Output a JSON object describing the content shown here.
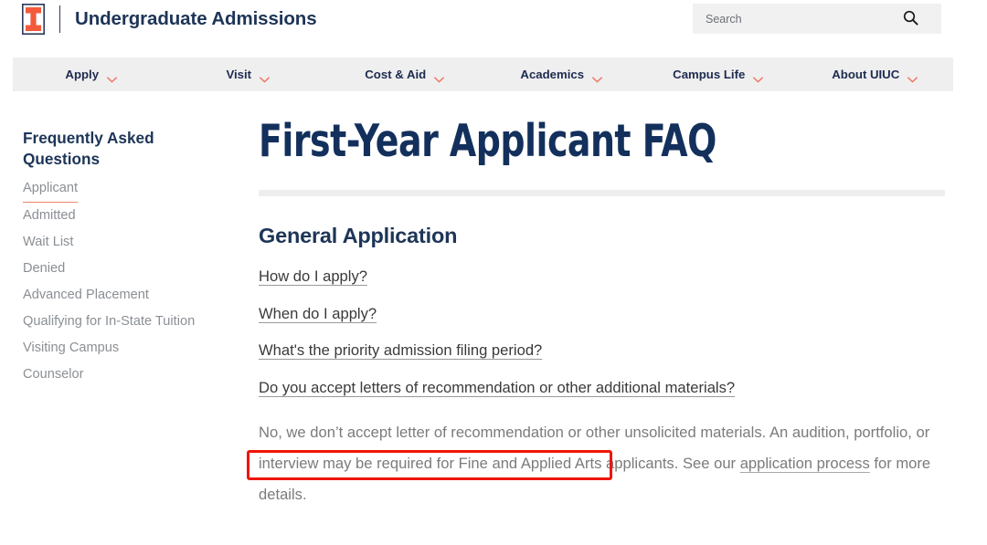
{
  "header": {
    "logo_icon": "illinois-block-i-logo",
    "title": "Undergraduate Admissions",
    "search": {
      "placeholder": "Search",
      "value": "",
      "icon": "search-icon"
    }
  },
  "nav": {
    "items": [
      {
        "label": "Apply",
        "icon": "chevron-down-icon"
      },
      {
        "label": "Visit",
        "icon": "chevron-down-icon"
      },
      {
        "label": "Cost & Aid",
        "icon": "chevron-down-icon"
      },
      {
        "label": "Academics",
        "icon": "chevron-down-icon"
      },
      {
        "label": "Campus Life",
        "icon": "chevron-down-icon"
      },
      {
        "label": "About UIUC",
        "icon": "chevron-down-icon"
      }
    ]
  },
  "sidebar": {
    "title": "Frequently Asked Questions",
    "items": [
      {
        "label": "Applicant",
        "active": true
      },
      {
        "label": "Admitted",
        "active": false
      },
      {
        "label": "Wait List",
        "active": false
      },
      {
        "label": "Denied",
        "active": false
      },
      {
        "label": "Advanced Placement",
        "active": false
      },
      {
        "label": "Qualifying for In-State Tuition",
        "active": false
      },
      {
        "label": "Visiting Campus",
        "active": false
      },
      {
        "label": "Counselor",
        "active": false
      }
    ]
  },
  "main": {
    "page_title": "First-Year Applicant FAQ",
    "section_heading": "General Application",
    "questions": [
      "How do I apply?",
      "When do I apply?",
      "What's the priority admission filing period?",
      "Do you accept letters of recommendation or other additional materials?"
    ],
    "answer": {
      "highlighted_text": "No, we don’t accept letter of recommendation",
      "rest_before_link": " or other unsolicited materials. An audition, portfolio, or interview may be required for Fine and Applied Arts applicants. See our ",
      "link_text": "application process",
      "rest_after_link": " for more details."
    }
  },
  "annotation": {
    "type": "red-highlight-box",
    "color": "#f01505"
  },
  "colors": {
    "brand_orange": "#f4593c",
    "brand_navy": "#13305c",
    "nav_bg": "#efefef",
    "accent_underline": "#f0866b",
    "annotation_red": "#f01505"
  }
}
